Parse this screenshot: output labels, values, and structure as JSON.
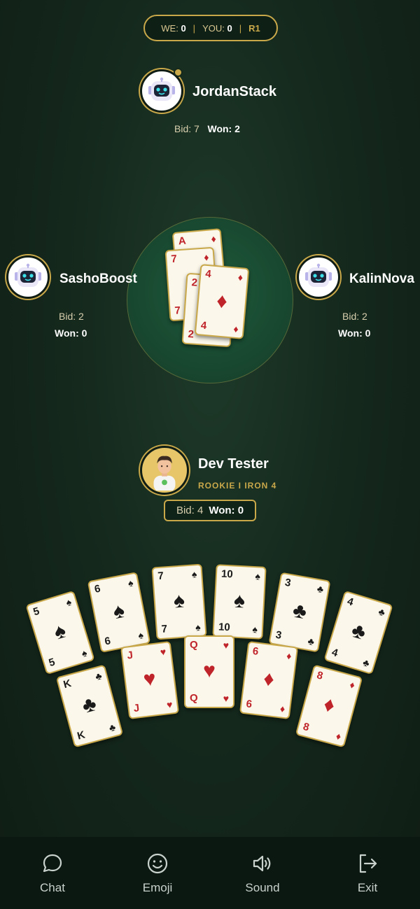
{
  "score": {
    "we_label": "WE:",
    "we_value": "0",
    "you_label": "YOU:",
    "you_value": "0",
    "round": "R1",
    "separator": "|"
  },
  "players": {
    "top": {
      "name": "JordanStack",
      "bid_label": "Bid:",
      "bid": "7",
      "won_label": "Won:",
      "won": "2",
      "avatar": "robot-icon",
      "is_dealer": true
    },
    "left": {
      "name": "SashoBoost",
      "bid_label": "Bid:",
      "bid": "2",
      "won_label": "Won:",
      "won": "0",
      "avatar": "robot-icon"
    },
    "right": {
      "name": "KalinNova",
      "bid_label": "Bid:",
      "bid": "2",
      "won_label": "Won:",
      "won": "0",
      "avatar": "robot-icon"
    },
    "me": {
      "name": "Dev Tester",
      "rank": "ROOKIE I IRON 4",
      "bid_label": "Bid:",
      "bid": "4",
      "won_label": "Won:",
      "won": "0",
      "avatar": "person-avatar"
    }
  },
  "trick": [
    {
      "rank": "A",
      "suit": "♦",
      "color": "red"
    },
    {
      "rank": "7",
      "suit": "♦",
      "color": "red"
    },
    {
      "rank": "2",
      "suit": "♦",
      "color": "red"
    },
    {
      "rank": "4",
      "suit": "♦",
      "color": "red"
    }
  ],
  "hand_top": [
    {
      "rank": "5",
      "suit": "♠",
      "color": "black"
    },
    {
      "rank": "6",
      "suit": "♠",
      "color": "black"
    },
    {
      "rank": "7",
      "suit": "♠",
      "color": "black"
    },
    {
      "rank": "10",
      "suit": "♠",
      "color": "black"
    },
    {
      "rank": "3",
      "suit": "♣",
      "color": "black"
    },
    {
      "rank": "4",
      "suit": "♣",
      "color": "black"
    }
  ],
  "hand_bottom": [
    {
      "rank": "K",
      "suit": "♣",
      "color": "black"
    },
    {
      "rank": "J",
      "suit": "♥",
      "color": "red"
    },
    {
      "rank": "Q",
      "suit": "♥",
      "color": "red"
    },
    {
      "rank": "6",
      "suit": "♦",
      "color": "red"
    },
    {
      "rank": "8",
      "suit": "♦",
      "color": "red"
    }
  ],
  "nav": [
    {
      "label": "Chat",
      "icon": "chat-icon"
    },
    {
      "label": "Emoji",
      "icon": "emoji-icon"
    },
    {
      "label": "Sound",
      "icon": "sound-icon"
    },
    {
      "label": "Exit",
      "icon": "exit-icon"
    }
  ],
  "colors": {
    "accent": "#c9a84a",
    "felt": "#194a31",
    "background": "#15291d",
    "red_suit": "#c0242b"
  }
}
